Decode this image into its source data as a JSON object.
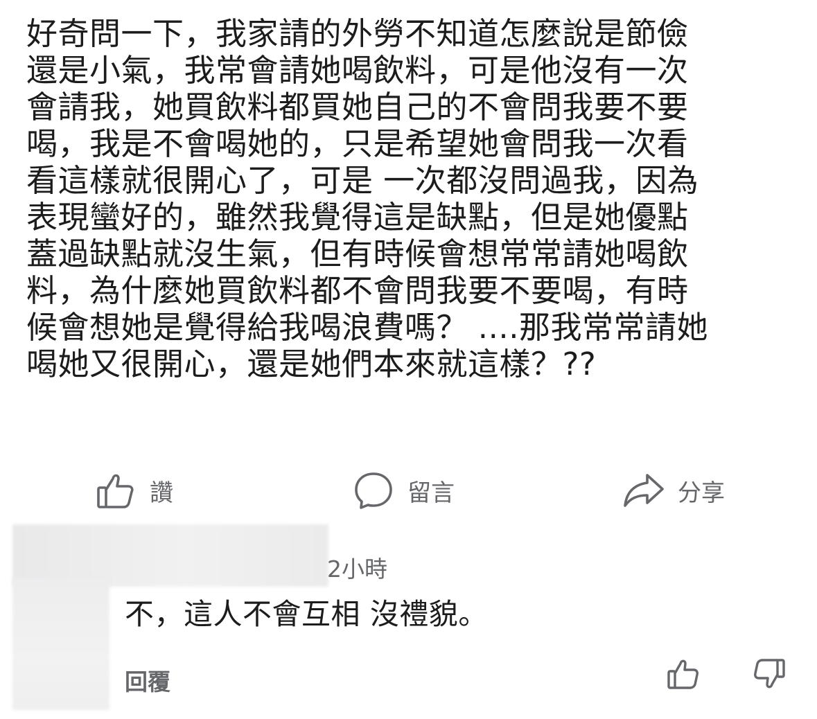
{
  "post": {
    "lines": [
      "好奇問一下，我家請的外勞不知道怎麼說是節儉",
      "還是小氣，我常會請她喝飲料，可是他沒有一次",
      "會請我，她買飲料都買她自己的不會問我要不要",
      "喝，我是不會喝她的，只是希望她會問我一次看",
      "看這樣就很開心了，可是 一次都沒問過我，因為",
      "表現蠻好的，雖然我覺得這是缺點，但是她優點",
      "蓋過缺點就沒生氣，但有時候會想常常請她喝飲",
      "料，為什麼她買飲料都不會問我要不要喝，有時",
      "候會想她是覺得給我喝浪費嗎？ ....那我常常請她",
      "喝她又很開心，還是她們本來就這樣？??"
    ]
  },
  "actions": {
    "like_label": "讚",
    "comment_label": "留言",
    "share_label": "分享",
    "like_icon": "thumbs-up-icon",
    "comment_icon": "speech-bubble-icon",
    "share_icon": "share-arrow-icon"
  },
  "comment": {
    "timestamp": "2小時",
    "text": "不，這人不會互相 沒禮貌。",
    "reply_label": "回覆"
  },
  "colors": {
    "text": "#1c1c1c",
    "secondary": "#65676b",
    "background": "#ffffff"
  }
}
